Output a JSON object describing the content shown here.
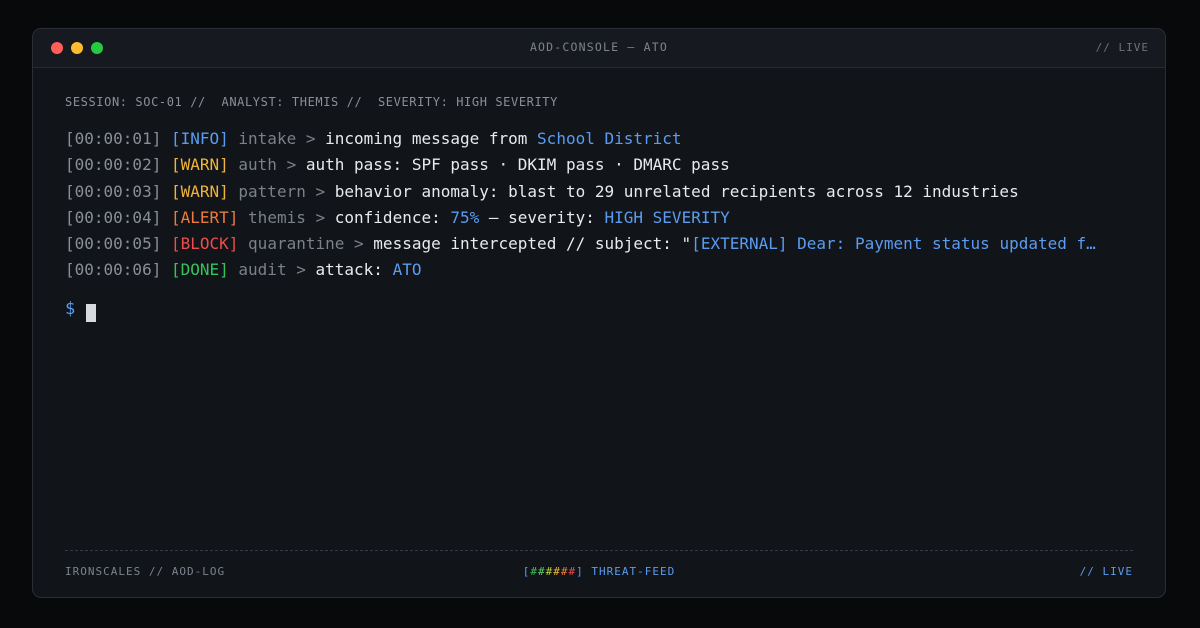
{
  "window": {
    "title": "AOD-CONSOLE — ATO",
    "live_label": "// LIVE"
  },
  "session": {
    "text": "SESSION: SOC-01 //  ANALYST: THEMIS //  SEVERITY: HIGH SEVERITY"
  },
  "log": [
    {
      "ts": "[00:00:01]",
      "tag": "[INFO]",
      "module": "intake",
      "sep": ">",
      "text": "incoming message from ",
      "highlight": "School District",
      "tail": ""
    },
    {
      "ts": "[00:00:02]",
      "tag": "[WARN]",
      "module": "auth",
      "sep": ">",
      "text": "auth pass: SPF pass · DKIM pass · DMARC pass",
      "highlight": "",
      "tail": ""
    },
    {
      "ts": "[00:00:03]",
      "tag": "[WARN]",
      "module": "pattern",
      "sep": ">",
      "text": "behavior anomaly: blast to 29 unrelated recipients across 12 industries",
      "highlight": "",
      "tail": ""
    },
    {
      "ts": "[00:00:04]",
      "tag": "[ALERT]",
      "module": "themis",
      "sep": ">",
      "text": "confidence: ",
      "highlight": "75%",
      "mid": " — severity: ",
      "highlight2": "HIGH SEVERITY"
    },
    {
      "ts": "[00:00:05]",
      "tag": "[BLOCK]",
      "module": "quarantine",
      "sep": ">",
      "text": "message intercepted // subject: \"",
      "highlight": "[EXTERNAL] Dear: Payment status updated f…",
      "tail": ""
    },
    {
      "ts": "[00:00:06]",
      "tag": "[DONE]",
      "module": "audit",
      "sep": ">",
      "text": "attack: ",
      "highlight": "ATO",
      "tail": ""
    }
  ],
  "prompt": {
    "symbol": "$"
  },
  "footer": {
    "left": "IRONSCALES // AOD-LOG",
    "bar_open": "[",
    "bar_chars": [
      "#",
      "#",
      "#",
      "#",
      "#",
      "#"
    ],
    "bar_close": "]",
    "feed_label": " THREAT-FEED",
    "right": "// LIVE"
  },
  "colors": {
    "info": "#5b9cf0",
    "warn": "#f0b43c",
    "alert": "#f07a3c",
    "block": "#ee4d4d",
    "done": "#35c45a"
  }
}
